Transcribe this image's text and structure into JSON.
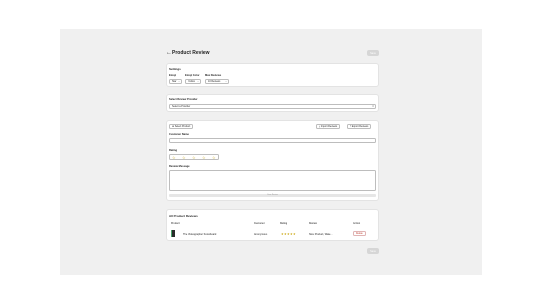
{
  "header": {
    "back_icon": "arrow-left-icon",
    "title": "Product Review",
    "save_label": "Save"
  },
  "settings": {
    "heading": "Settings",
    "emoji": {
      "label": "Emoji",
      "value": "Star"
    },
    "emoji_color": {
      "label": "Emoji Color",
      "value": "Yellow"
    },
    "max_reviews": {
      "label": "Max Reviews",
      "value": "10 Reviews"
    }
  },
  "provider": {
    "label": "Select Review Provider",
    "value": "Select a Provider"
  },
  "form": {
    "select_product": "Select Product",
    "import_reviews": "Import Reviews",
    "export_reviews": "Export Reviews",
    "customer_name_label": "Customer Name",
    "customer_name_value": "",
    "rating_label": "Rating",
    "rating_value": 0,
    "review_message_label": "Review Message",
    "review_message_value": "",
    "submit_label": "Save Review"
  },
  "reviews": {
    "heading": "All Product Reviews",
    "columns": [
      "Product",
      "Customer",
      "Rating",
      "Review",
      "Action"
    ],
    "rows": [
      {
        "product": "The Videographer Snowboard",
        "customer": "Anonymous",
        "rating": 5,
        "rating_stars": "★★★★★",
        "review": "Nice Product, Wate...",
        "action": "Delete"
      }
    ]
  },
  "footer": {
    "save_label": "Save"
  },
  "colors": {
    "star": "#c8a200",
    "delete": "#c0392b",
    "frame_bg": "#f0f0f0"
  }
}
